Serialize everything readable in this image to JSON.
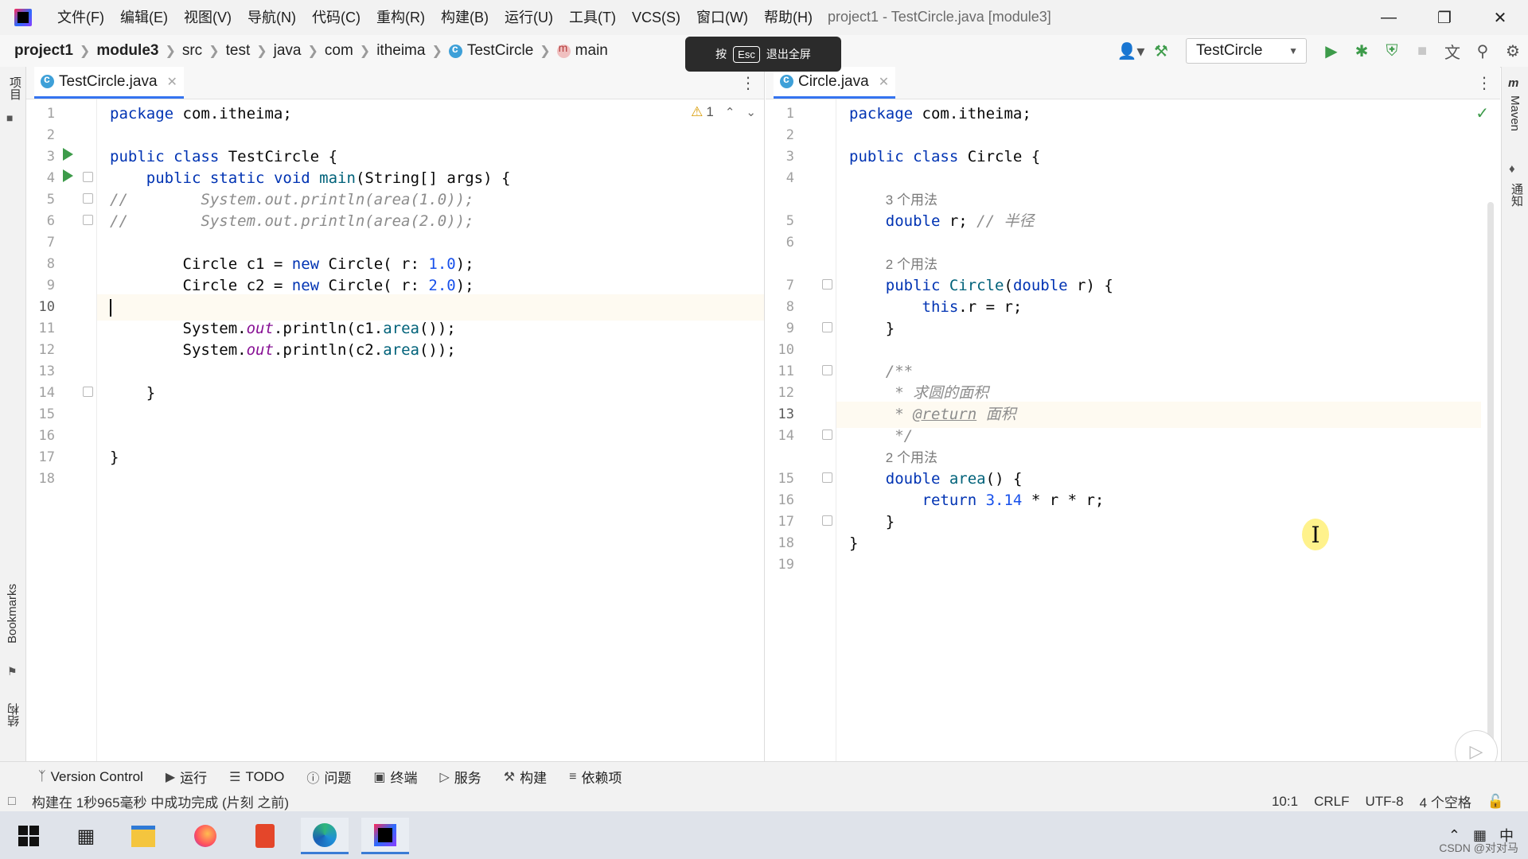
{
  "window": {
    "title": "project1 - TestCircle.java [module3]"
  },
  "menubar": [
    "文件(F)",
    "编辑(E)",
    "视图(V)",
    "导航(N)",
    "代码(C)",
    "重构(R)",
    "构建(B)",
    "运行(U)",
    "工具(T)",
    "VCS(S)",
    "窗口(W)",
    "帮助(H)"
  ],
  "breadcrumb": [
    "project1",
    "module3",
    "src",
    "test",
    "java",
    "com",
    "itheima",
    "TestCircle",
    "main"
  ],
  "fullscreen_tip": {
    "prefix": "按",
    "key": "Esc",
    "text": "退出全屏"
  },
  "run_config": {
    "name": "TestCircle"
  },
  "left_strip": {
    "project": "项目",
    "bookmarks": "Bookmarks",
    "structure": "结构"
  },
  "right_strip": {
    "maven": "Maven",
    "notifications": "通知"
  },
  "left_editor": {
    "tab": "TestCircle.java",
    "warnings": "1",
    "cursor_line": 10,
    "lines": [
      "package com.itheima;",
      "",
      "public class TestCircle {",
      "    public static void main(String[] args) {",
      "//        System.out.println(area(1.0));",
      "//        System.out.println(area(2.0));",
      "",
      "        Circle c1 = new Circle( r: 1.0);",
      "        Circle c2 = new Circle( r: 2.0);",
      "",
      "        System.out.println(c1.area());",
      "        System.out.println(c2.area());",
      "",
      "    }",
      "",
      "",
      "}",
      ""
    ]
  },
  "right_editor": {
    "tab": "Circle.java",
    "cursor_line": 13,
    "rows": [
      {
        "n": "1",
        "code": "package com.itheima;"
      },
      {
        "n": "2",
        "code": ""
      },
      {
        "n": "3",
        "code": "public class Circle {"
      },
      {
        "n": "4",
        "code": ""
      },
      {
        "n": "",
        "hint": "3 个用法"
      },
      {
        "n": "5",
        "code": "    double r; // 半径"
      },
      {
        "n": "6",
        "code": ""
      },
      {
        "n": "",
        "hint": "2 个用法"
      },
      {
        "n": "7",
        "code": "    public Circle(double r) {"
      },
      {
        "n": "8",
        "code": "        this.r = r;"
      },
      {
        "n": "9",
        "code": "    }"
      },
      {
        "n": "10",
        "code": ""
      },
      {
        "n": "11",
        "code": "    /**"
      },
      {
        "n": "12",
        "code": "     * 求圆的面积"
      },
      {
        "n": "13",
        "code": "     * @return 面积"
      },
      {
        "n": "14",
        "code": "     */"
      },
      {
        "n": "",
        "hint": "2 个用法"
      },
      {
        "n": "15",
        "code": "    double area() {"
      },
      {
        "n": "16",
        "code": "        return 3.14 * r * r;"
      },
      {
        "n": "17",
        "code": "    }"
      },
      {
        "n": "18",
        "code": "}"
      },
      {
        "n": "19",
        "code": ""
      }
    ]
  },
  "toolwindows": [
    "Version Control",
    "运行",
    "TODO",
    "问题",
    "终端",
    "服务",
    "构建",
    "依赖项"
  ],
  "status": {
    "message": "构建在 1秒965毫秒 中成功完成 (片刻 之前)",
    "position": "10:1",
    "line_separator": "CRLF",
    "encoding": "UTF-8",
    "indent": "4 个空格"
  },
  "tray": {
    "ime": "中"
  },
  "watermark": "CSDN @对对马",
  "colors": {
    "keyword": "#0033b3",
    "number": "#1750eb",
    "comment": "#8c8c8c",
    "run": "#3d9b4a",
    "accent": "#3574f0"
  }
}
